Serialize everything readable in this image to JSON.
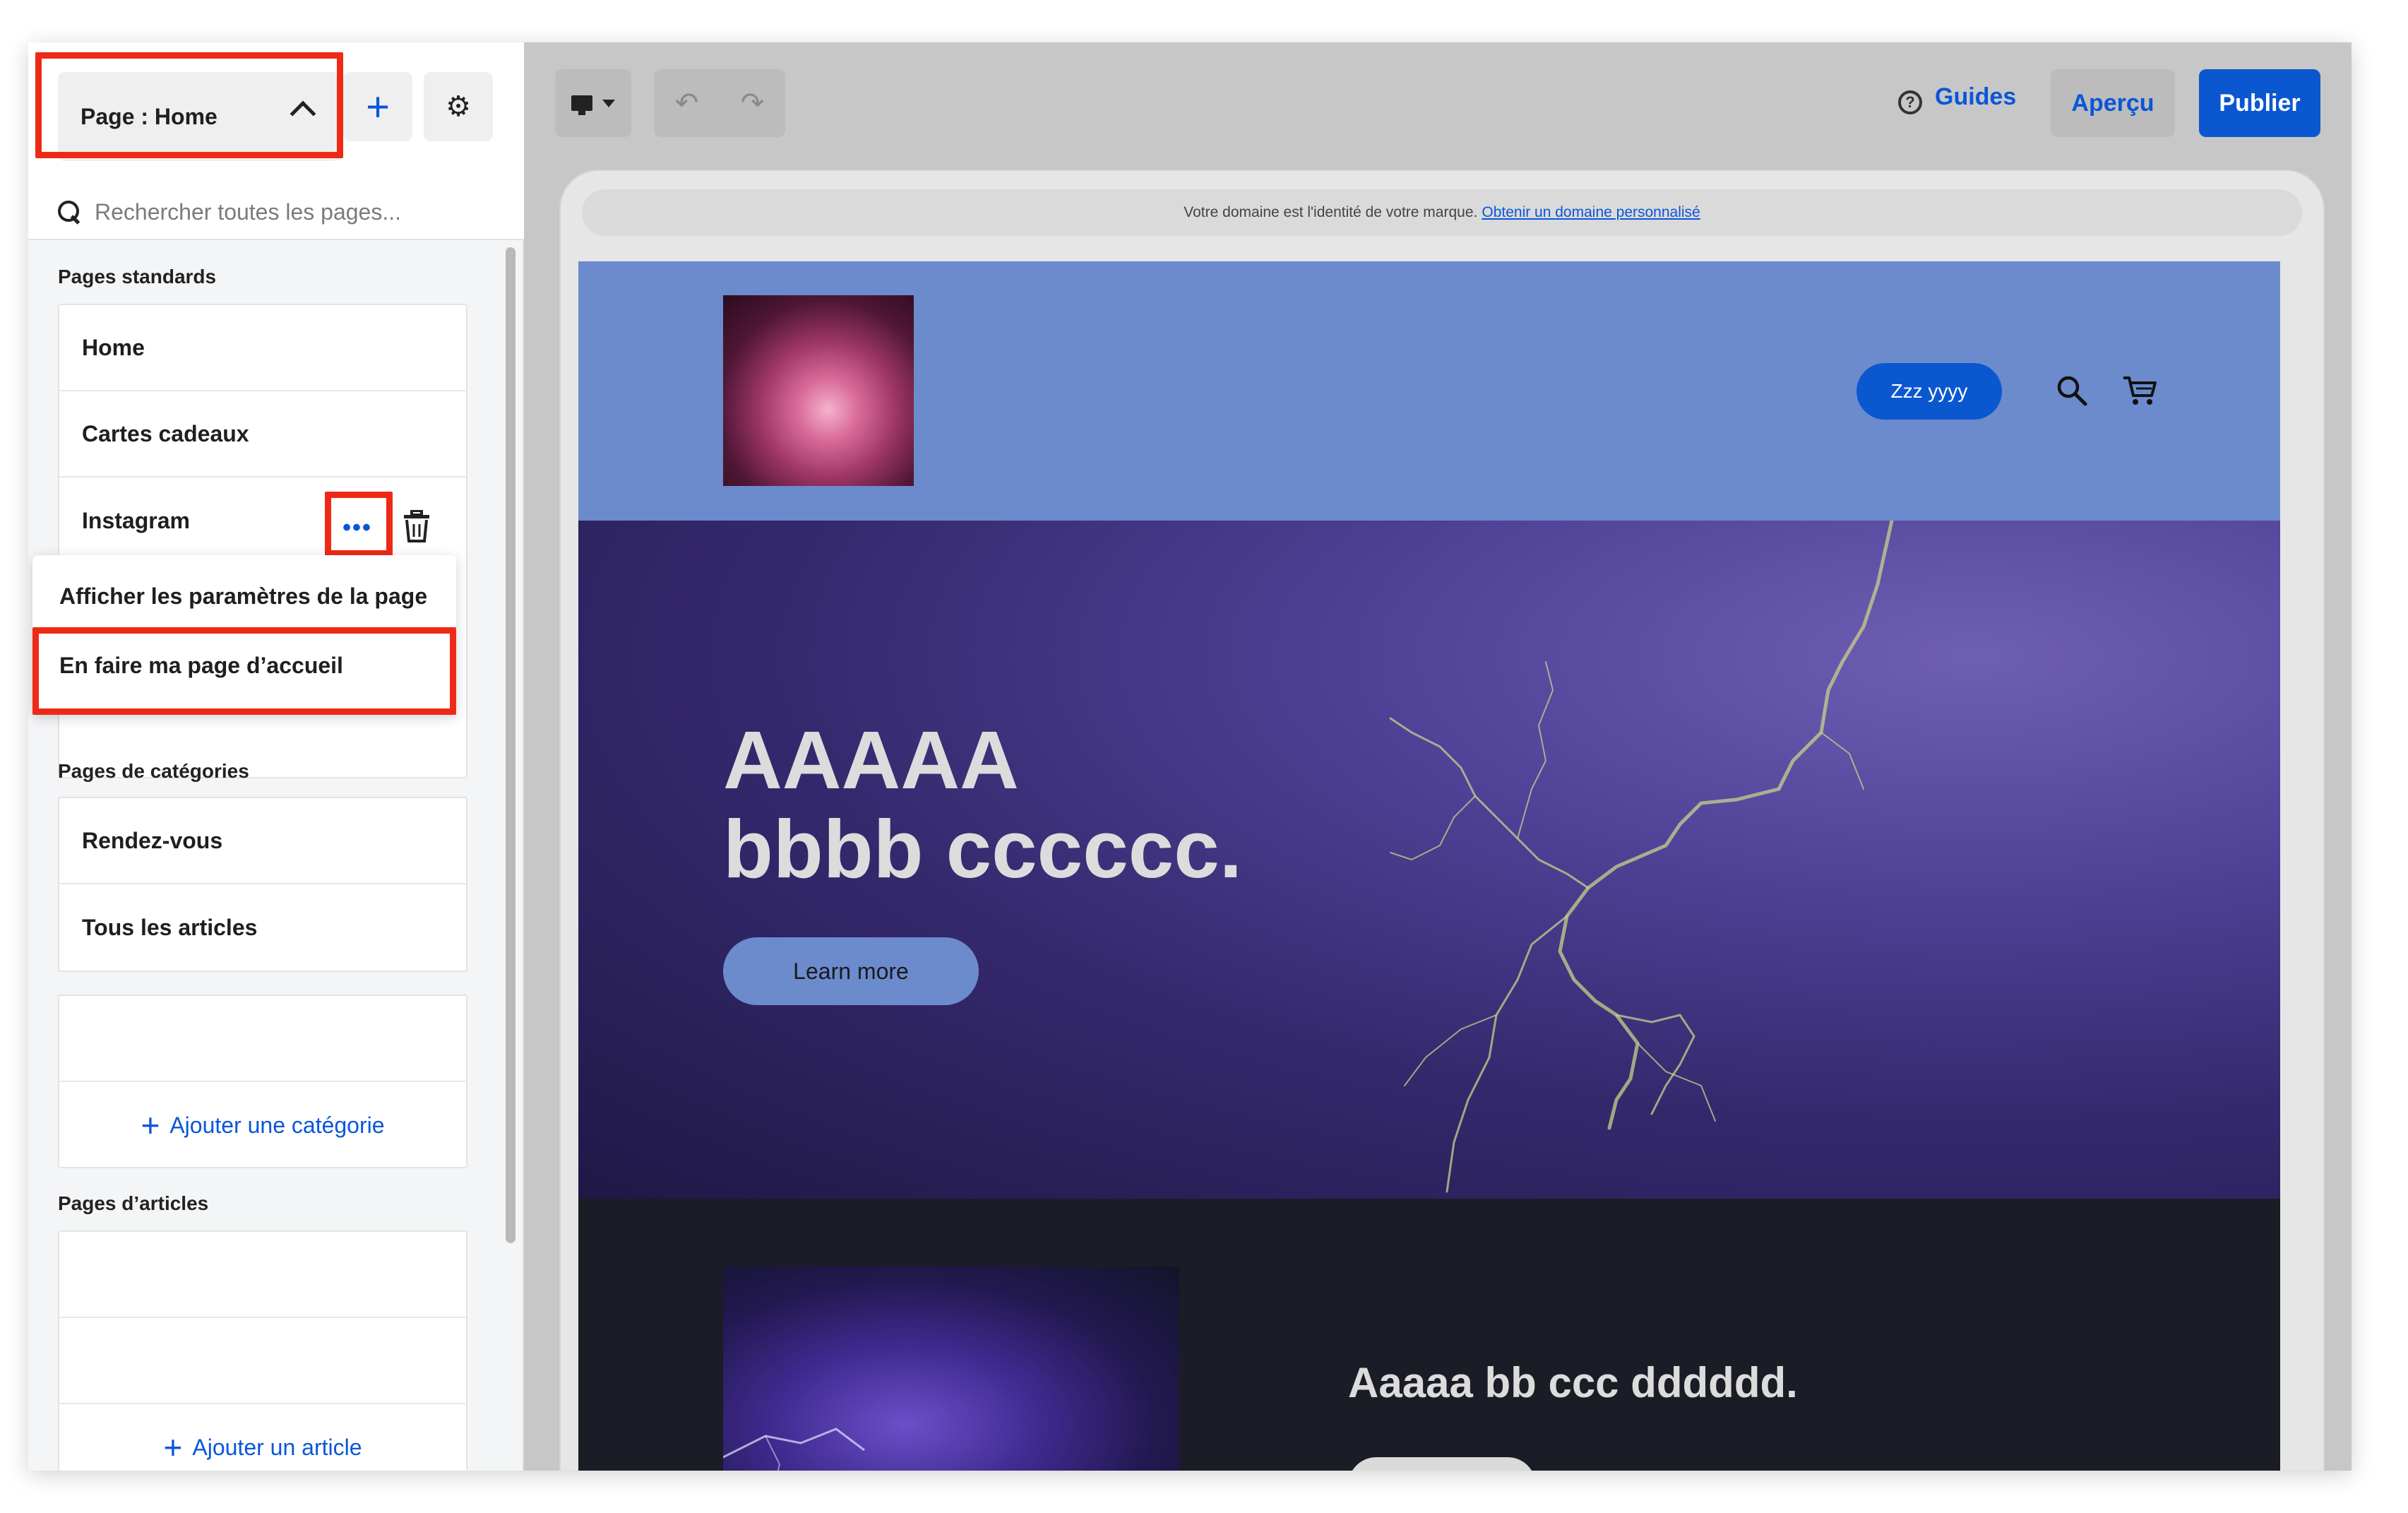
{
  "sidebar": {
    "page_selector_label": "Page : Home",
    "search_placeholder": "Rechercher toutes les pages...",
    "standard_heading": "Pages standards",
    "standard_pages": [
      "Home",
      "Cartes cadeaux",
      "Instagram"
    ],
    "context_menu": {
      "items": [
        "Afficher les paramètres de la page",
        "En faire ma page d’accueil"
      ]
    },
    "category_heading": "Pages de catégories",
    "category_pages": [
      "Rendez-vous",
      "Tous les articles"
    ],
    "add_category": "Ajouter une catégorie",
    "article_heading": "Pages d’articles",
    "add_article": "Ajouter un article"
  },
  "toolbar": {
    "guides_label": "Guides",
    "preview_label": "Aperçu",
    "publish_label": "Publier",
    "help_glyph": "?",
    "plus_glyph": "+",
    "gear_glyph": "⚙",
    "more_glyph": "•••",
    "undo_glyph": "↶",
    "redo_glyph": "↷"
  },
  "domain_bar": {
    "text": "Votre domaine est l'identité de votre marque.",
    "link": "Obtenir un domaine personnalisé"
  },
  "site": {
    "header_button": "Zzz yyyy",
    "hero_line1": "AAAAA",
    "hero_line2": "bbbb cccccc.",
    "hero_button": "Learn more",
    "section_title": "Aaaaa bb ccc dddddd."
  },
  "colors": {
    "accent": "#0b57d0",
    "highlight": "#ee2a16",
    "header_bg": "#6b8bcd"
  }
}
